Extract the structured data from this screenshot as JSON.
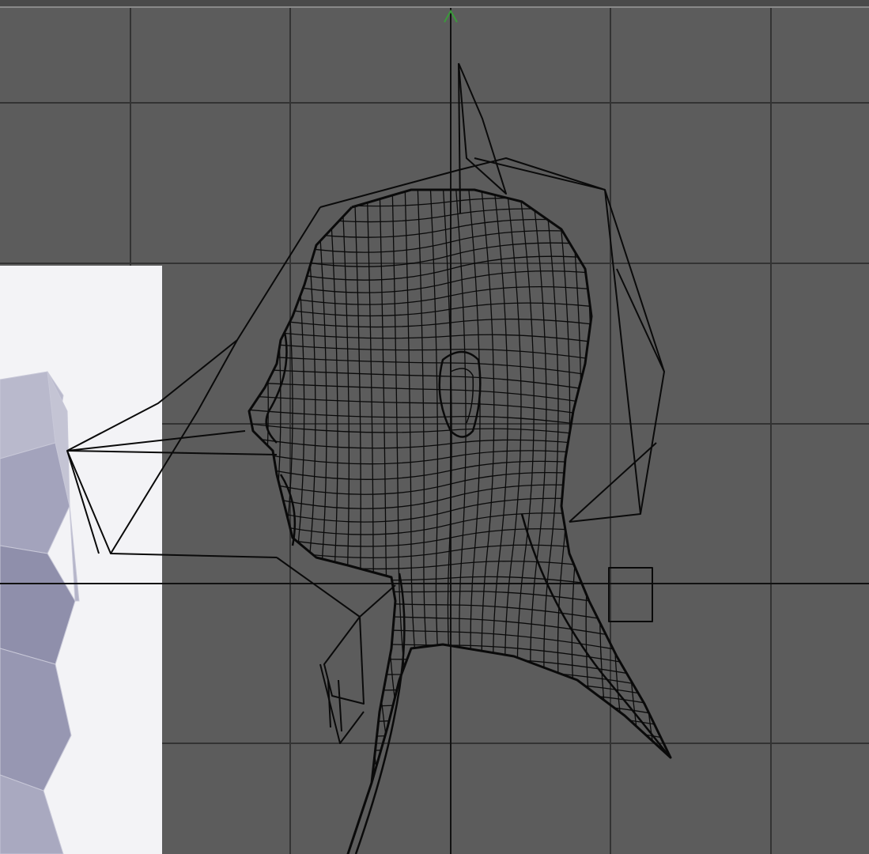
{
  "viewport": {
    "view": "side",
    "colors": {
      "background": "#5c5c5c",
      "grid": "#333333",
      "axis": "#111111",
      "wire": "#0a0a0a",
      "reference_panel": "#f3f3f6",
      "reference_mesh": "#9a9ab4",
      "axis_widget": "#3a9a3a"
    }
  }
}
